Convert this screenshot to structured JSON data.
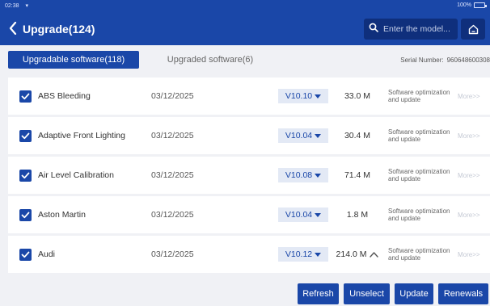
{
  "status": {
    "time": "02:38",
    "battery": "100%"
  },
  "header": {
    "title": "Upgrade(124)",
    "search_placeholder": "Enter the model..."
  },
  "tabs": [
    {
      "label": "Upgradable software(118)"
    },
    {
      "label": "Upgraded software(6)"
    }
  ],
  "serial": {
    "label": "Serial Number:",
    "value": "960648600308"
  },
  "rows": [
    {
      "name": "ABS Bleeding",
      "date": "03/12/2025",
      "version": "V10.10",
      "size": "33.0 M",
      "desc": "Software optimization and update",
      "more": "More>>",
      "checked": true
    },
    {
      "name": "Adaptive Front Lighting",
      "date": "03/12/2025",
      "version": "V10.04",
      "size": "30.4 M",
      "desc": "Software optimization and update",
      "more": "More>>",
      "checked": true
    },
    {
      "name": "Air Level Calibration",
      "date": "03/12/2025",
      "version": "V10.08",
      "size": "71.4 M",
      "desc": "Software optimization and update",
      "more": "More>>",
      "checked": true
    },
    {
      "name": "Aston Martin",
      "date": "03/12/2025",
      "version": "V10.04",
      "size": "1.8 M",
      "desc": "Software optimization and update",
      "more": "More>>",
      "checked": true
    },
    {
      "name": "Audi",
      "date": "03/12/2025",
      "version": "V10.12",
      "size": "214.0 M",
      "desc": "Software optimization and update",
      "more": "More>>",
      "checked": true
    }
  ],
  "buttons": {
    "refresh": "Refresh",
    "unselect": "Unselect",
    "update": "Update",
    "renewals": "Renewals"
  }
}
